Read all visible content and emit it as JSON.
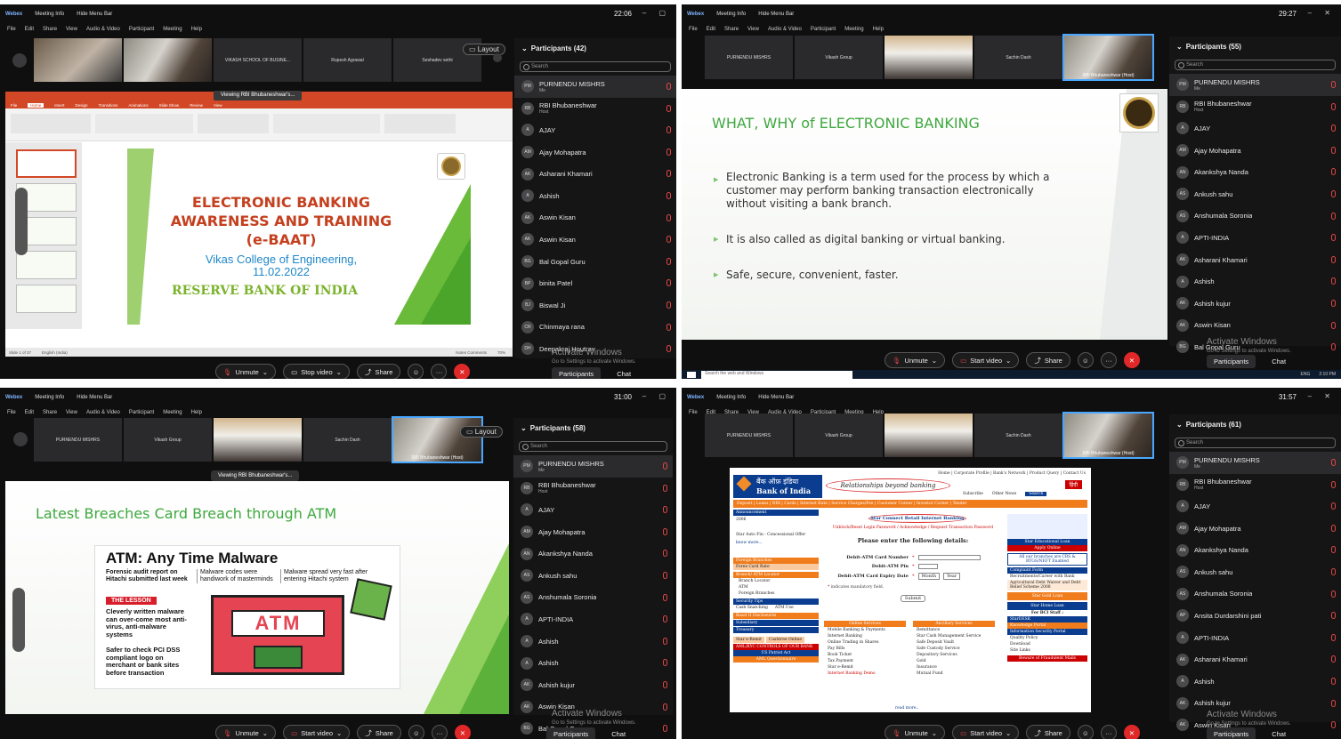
{
  "q1": {
    "app": "Webex",
    "meeting_info": "Meeting Info",
    "hide_menu": "Hide Menu Bar",
    "clock": "22:06",
    "menu": [
      "File",
      "Edit",
      "Share",
      "View",
      "Audio & Video",
      "Participant",
      "Meeting",
      "Help"
    ],
    "tiles": [
      "",
      "",
      "VIKASH SCHOOL OF BUSINE...",
      "Rupesh Agrawal",
      "Seshadev sethi"
    ],
    "layout": "Layout",
    "ppt_banner": "Viewing RBI Bhubaneshwar's...",
    "ppt_tabs": [
      "File",
      "Home",
      "Insert",
      "Design",
      "Transitions",
      "Animations",
      "Slide Show",
      "Review",
      "View"
    ],
    "slide": {
      "title1": "ELECTRONIC BANKING",
      "title2": "AWARENESS AND TRAINING",
      "title3": "(e-BAAT)",
      "college": "Vikas College of Engineering,",
      "date": "11.02.2022",
      "rbi": "RESERVE BANK OF INDIA"
    },
    "status_left": "Slide 1 of 37",
    "status_lang": "English (India)",
    "status_right": "Notes   Comments",
    "zoom": "70%",
    "participants_title": "Participants (42)",
    "search": "Search",
    "participants": [
      {
        "init": "PM",
        "name": "PURNENDU MISHRS",
        "sub": "Me"
      },
      {
        "init": "RB",
        "name": "RBI Bhubaneshwar",
        "sub": "Host"
      },
      {
        "init": "A",
        "name": "AJAY",
        "sub": ""
      },
      {
        "init": "AM",
        "name": "Ajay Mohapatra",
        "sub": ""
      },
      {
        "init": "AK",
        "name": "Asharani Khamari",
        "sub": ""
      },
      {
        "init": "A",
        "name": "Ashish",
        "sub": ""
      },
      {
        "init": "AK",
        "name": "Aswin Kisan",
        "sub": ""
      },
      {
        "init": "AK",
        "name": "Aswin Kisan",
        "sub": ""
      },
      {
        "init": "BG",
        "name": "Bal Gopal Guru",
        "sub": ""
      },
      {
        "init": "BP",
        "name": "binita Patel",
        "sub": ""
      },
      {
        "init": "BJ",
        "name": "Biswal Ji",
        "sub": ""
      },
      {
        "init": "CR",
        "name": "Chinmaya rana",
        "sub": ""
      },
      {
        "init": "DH",
        "name": "Deepakraj Houtray",
        "sub": ""
      }
    ],
    "controls": [
      "Unmute",
      "Stop video",
      "Share"
    ],
    "ptab": [
      "Participants",
      "Chat"
    ],
    "activate1": "Activate Windows",
    "activate2": "Go to Settings to activate Windows."
  },
  "q2": {
    "app": "Webex",
    "meeting_info": "Meeting Info",
    "hide_menu": "Hide Menu Bar",
    "clock": "29:27",
    "menu": [
      "File",
      "Edit",
      "Share",
      "View",
      "Audio & Video",
      "Participant",
      "Meeting",
      "Help"
    ],
    "tiles": [
      "PURNENDU MISHRS",
      "Vikash Group",
      "",
      "Sachin Dash",
      "RBI Bhubaneshwar (Host)"
    ],
    "tile_sub": "Me",
    "slide": {
      "title": "WHAT, WHY of ELECTRONIC BANKING",
      "b1": "Electronic Banking is a term used for the process by which a customer may perform banking transaction electronically without visiting a bank branch.",
      "b2": "It is also called as digital banking or virtual banking.",
      "b3": "Safe, secure, convenient, faster."
    },
    "participants_title": "Participants (55)",
    "search": "Search",
    "participants": [
      {
        "init": "PM",
        "name": "PURNENDU MISHRS",
        "sub": "Me"
      },
      {
        "init": "RB",
        "name": "RBI Bhubaneshwar",
        "sub": "Host"
      },
      {
        "init": "A",
        "name": "AJAY",
        "sub": ""
      },
      {
        "init": "AM",
        "name": "Ajay Mohapatra",
        "sub": ""
      },
      {
        "init": "AN",
        "name": "Akankshya Nanda",
        "sub": ""
      },
      {
        "init": "AS",
        "name": "Ankush sahu",
        "sub": ""
      },
      {
        "init": "AS",
        "name": "Anshumala Soronia",
        "sub": ""
      },
      {
        "init": "A",
        "name": "APTI-INDIA",
        "sub": ""
      },
      {
        "init": "AK",
        "name": "Asharani Khamari",
        "sub": ""
      },
      {
        "init": "A",
        "name": "Ashish",
        "sub": ""
      },
      {
        "init": "AK",
        "name": "Ashish kujur",
        "sub": ""
      },
      {
        "init": "AK",
        "name": "Aswin Kisan",
        "sub": ""
      },
      {
        "init": "BG",
        "name": "Bal Gopal Guru",
        "sub": ""
      }
    ],
    "controls": [
      "Unmute",
      "Start video",
      "Share"
    ],
    "ptab": [
      "Participants",
      "Chat"
    ],
    "activate1": "Activate Windows",
    "activate2": "Go to Settings to activate Windows.",
    "taskbar_search": "Search the web and Windows",
    "taskbar_time": "2:10 PM",
    "taskbar_lang": "ENG"
  },
  "q3": {
    "app": "Webex",
    "meeting_info": "Meeting Info",
    "hide_menu": "Hide Menu Bar",
    "clock": "31:00",
    "menu": [
      "File",
      "Edit",
      "Share",
      "View",
      "Audio & Video",
      "Participant",
      "Meeting",
      "Help"
    ],
    "tiles": [
      "PURNENDU MISHRS",
      "Vikash Group",
      "",
      "Sachin Dash",
      "RBI Bhubaneshwar (Host)"
    ],
    "tile_sub": "Me",
    "layout": "Layout",
    "banner": "Viewing RBI Bhubaneshwar's...",
    "slide": {
      "title": "Latest Breaches  Card Breach through ATM",
      "headline": "ATM: Any Time Malware",
      "c1a": "Forensic audit report on Hitachi submitted last week",
      "c2a": "Malware codes were handiwork of masterminds",
      "c3a": "Malware spread very fast after entering Hitachi system",
      "lesson": "THE LESSON",
      "l1": "Cleverly written malware can over-come most anti-virus, anti-malware systems",
      "l2": "Safer to check PCI DSS compliant logo on merchant or bank sites before transaction",
      "atm": "ATM"
    },
    "participants_title": "Participants (58)",
    "search": "Search",
    "participants": [
      {
        "init": "PM",
        "name": "PURNENDU MISHRS",
        "sub": "Me"
      },
      {
        "init": "RB",
        "name": "RBI Bhubaneshwar",
        "sub": "Host"
      },
      {
        "init": "A",
        "name": "AJAY",
        "sub": ""
      },
      {
        "init": "AM",
        "name": "Ajay Mohapatra",
        "sub": ""
      },
      {
        "init": "AN",
        "name": "Akankshya Nanda",
        "sub": ""
      },
      {
        "init": "AS",
        "name": "Ankush sahu",
        "sub": ""
      },
      {
        "init": "AS",
        "name": "Anshumala Soronia",
        "sub": ""
      },
      {
        "init": "A",
        "name": "APTI-INDIA",
        "sub": ""
      },
      {
        "init": "A",
        "name": "Ashish",
        "sub": ""
      },
      {
        "init": "A",
        "name": "Ashish",
        "sub": ""
      },
      {
        "init": "AK",
        "name": "Ashish kujur",
        "sub": ""
      },
      {
        "init": "AK",
        "name": "Aswin Kisan",
        "sub": ""
      },
      {
        "init": "BG",
        "name": "Bal Gopal Guru",
        "sub": ""
      }
    ],
    "controls": [
      "Unmute",
      "Start video",
      "Share"
    ],
    "ptab": [
      "Participants",
      "Chat"
    ],
    "activate1": "Activate Windows",
    "activate2": "Go to Settings to activate Windows."
  },
  "q4": {
    "app": "Webex",
    "meeting_info": "Meeting Info",
    "hide_menu": "Hide Menu Bar",
    "clock": "31:57",
    "menu": [
      "File",
      "Edit",
      "Share",
      "View",
      "Audio & Video",
      "Participant",
      "Meeting",
      "Help"
    ],
    "tiles": [
      "PURNENDU MISHRS",
      "Vikash Group",
      "",
      "Sachin Dash",
      "RBI Bhubaneshwar (Host)"
    ],
    "tile_sub": "Me",
    "sbi": {
      "toplinks": "Home | Corporate Profile | Bank's Network | Product Query | Contact Us",
      "hindi_name": "बैंक ऑफ़ इंडिया",
      "name": "Bank of India",
      "tagline": "Relationships beyond banking",
      "hindi_btn": "हिंदी",
      "subscribe": "Subscribe",
      "other_news": "Other News",
      "search_btn": "Search",
      "nav": "Deposit | Loans | NRI | Cards | Internet Rate | Service Charges/Fee | Customer Corner | Investor Corner | Tender",
      "announcement": "Announcement",
      "left_items": [
        "2006",
        "Star Auto Fin - Concessional Offer",
        "know more..."
      ],
      "foreign": "Foreign Branches",
      "forex": "Forex Card Rate",
      "branch_atm": "Branch/ ATM Locator",
      "left_list": [
        "Branch Locator",
        "ATM",
        "Foreign Branches"
      ],
      "security_tips": "Security Tips",
      "security_list": [
        "Cash Snatching",
        "ATM Use"
      ],
      "left_links": [
        "Basel II Disclosures",
        "Subsidiary",
        "Treasury"
      ],
      "remit": "Star e-Remit",
      "cashtree": "Cashtree Online",
      "amlkyc": "AML/KYC CONTROLS OF OUR BANK",
      "patriot": "US Patriot Act",
      "aml_q": "AML Questionnaire",
      "star_connect": "Star Connect Retail Internet Banking",
      "sublinks": "Unblock/Reset Login Password / Acknowledge / Request Transaction Password",
      "enter": "Please enter the following details:",
      "f1": "Debit-ATM Card Number",
      "f2": "Debit-ATM Pin",
      "f3": "Debit-ATM Card Expiry Date",
      "month": "Month",
      "year": "Year",
      "mandatory": "indicates mandatory field.",
      "submit": "Submit",
      "online": "Online Services",
      "online_list": [
        "Mobile Banking & Payments",
        "Internet Banking",
        "Online Trading in Shares",
        "Pay Bills",
        "Book Ticket",
        "Tax Payment",
        "Star e-Remit",
        "Internet Banking Demo"
      ],
      "ancillary": "Ancillary Services",
      "anc_list": [
        "Remittance",
        "Star Cash Management Service",
        "Safe Deposit Vault",
        "Safe Custody Service",
        "Depository Services",
        "Gold",
        "Insurance",
        "Mutual Fund"
      ],
      "read_more": "read more..",
      "right_items": [
        "Star Educational Loan",
        "Apply Online",
        "All our branches are CBS & RTGS/NEFT Enabled",
        "Complaint Form",
        "Recruitments/Career with Bank",
        "Agricultural Debt Waiver and Debt Relief Scheme 2008",
        "Star Gold Loan",
        "Star Home Loan",
        "For BCI Staff :",
        "StarDESK",
        "Knowledge Portal",
        "Information Security Portal",
        "Quality Policy",
        "Download",
        "Site Links",
        "Beware of Fraudulent Mails"
      ]
    },
    "participants_title": "Participants (61)",
    "search": "Search",
    "participants": [
      {
        "init": "PM",
        "name": "PURNENDU MISHRS",
        "sub": "Me"
      },
      {
        "init": "RB",
        "name": "RBI Bhubaneshwar",
        "sub": "Host"
      },
      {
        "init": "A",
        "name": "AJAY",
        "sub": ""
      },
      {
        "init": "AM",
        "name": "Ajay Mohapatra",
        "sub": ""
      },
      {
        "init": "AN",
        "name": "Akankshya Nanda",
        "sub": ""
      },
      {
        "init": "AS",
        "name": "Ankush sahu",
        "sub": ""
      },
      {
        "init": "AS",
        "name": "Anshumala Soronia",
        "sub": ""
      },
      {
        "init": "AP",
        "name": "Ansita Durdarshini pati",
        "sub": ""
      },
      {
        "init": "A",
        "name": "APTI-INDIA",
        "sub": ""
      },
      {
        "init": "AK",
        "name": "Asharani Khamari",
        "sub": ""
      },
      {
        "init": "A",
        "name": "Ashish",
        "sub": ""
      },
      {
        "init": "AK",
        "name": "Ashish kujur",
        "sub": ""
      },
      {
        "init": "AK",
        "name": "Aswin Kisan",
        "sub": ""
      }
    ],
    "controls": [
      "Unmute",
      "Start video",
      "Share"
    ],
    "ptab": [
      "Participants",
      "Chat"
    ],
    "activate1": "Activate Windows",
    "activate2": "Go to Settings to activate Windows."
  },
  "colors": {
    "accent": "#4aa7ff",
    "mute": "#e04545",
    "leave": "#e02828",
    "slide_green": "#3fa83f",
    "ppt_orange": "#d24726"
  }
}
